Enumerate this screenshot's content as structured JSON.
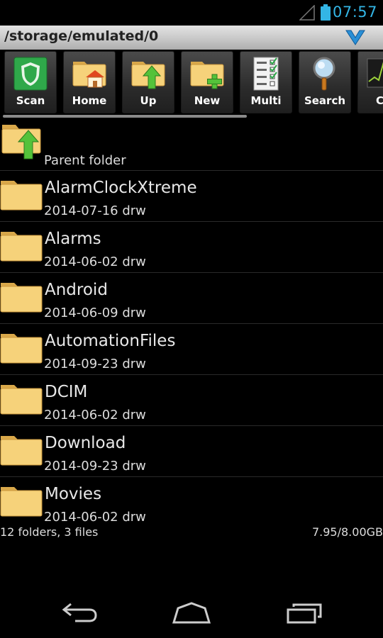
{
  "status_bar": {
    "time": "07:57",
    "accent": "#33b5e5"
  },
  "path_bar": {
    "path": "/storage/emulated/0"
  },
  "toolbar": {
    "buttons": [
      {
        "label": "Scan",
        "icon": "shield-icon"
      },
      {
        "label": "Home",
        "icon": "home-folder-icon"
      },
      {
        "label": "Up",
        "icon": "up-folder-icon"
      },
      {
        "label": "New",
        "icon": "new-folder-icon"
      },
      {
        "label": "Multi",
        "icon": "checklist-icon"
      },
      {
        "label": "Search",
        "icon": "magnifier-icon"
      },
      {
        "label": "CP",
        "icon": "cpu-graph-icon"
      }
    ]
  },
  "file_list": {
    "parent_label": "Parent folder",
    "items": [
      {
        "name": "AlarmClockXtreme",
        "meta": "2014-07-16 drw"
      },
      {
        "name": "Alarms",
        "meta": "2014-06-02 drw"
      },
      {
        "name": "Android",
        "meta": "2014-06-09 drw"
      },
      {
        "name": "AutomationFiles",
        "meta": "2014-09-23 drw"
      },
      {
        "name": "DCIM",
        "meta": "2014-06-02 drw"
      },
      {
        "name": "Download",
        "meta": "2014-09-23 drw"
      },
      {
        "name": "Movies",
        "meta": "2014-06-02 drw"
      }
    ]
  },
  "summary": {
    "counts": "12 folders, 3 files",
    "storage": "7.95/8.00GB"
  },
  "colors": {
    "folder": "#f6d27a",
    "folder_dark": "#d9a84a",
    "toolbar_bg": "#3a3a3a"
  }
}
